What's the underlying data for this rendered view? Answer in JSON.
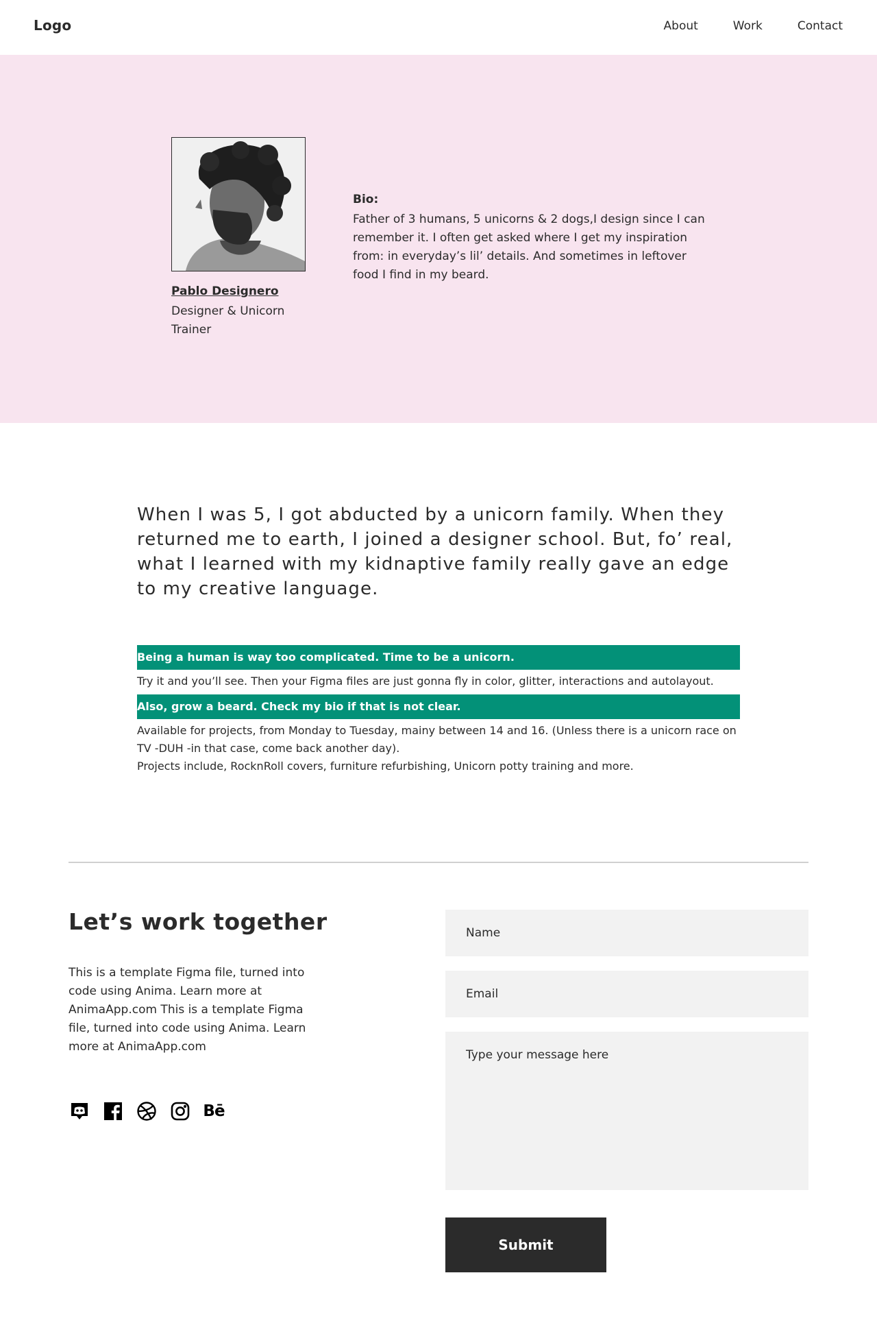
{
  "header": {
    "logo": "Logo",
    "nav": [
      "About",
      "Work",
      "Contact"
    ]
  },
  "hero": {
    "name": "Pablo Designero",
    "role": "Designer & Unicorn Trainer",
    "bio_label": "Bio:",
    "bio_text": "Father of 3 humans, 5 unicorns & 2 dogs,I design since I can remember it. I often get asked where I get my inspiration from: in everyday’s lil’ details. And sometimes in leftover food I find in my beard."
  },
  "story": {
    "quote": "When I was 5, I got abducted by a unicorn family. When they returned me to earth, I joined a designer school. But, fo’ real, what I learned with my kidnaptive family really gave an edge to my creative language.",
    "highlight_1": "Being a human is way too complicated. Time to be a unicorn.",
    "paragraph_1": "Try it and you’ll see. Then your Figma files are just gonna fly in color, glitter, interactions and autolayout.",
    "highlight_2": "Also, grow a beard. Check my bio if that is not clear.",
    "paragraph_2a": "Available for projects, from Monday to Tuesday, mainy between 14 and 16. (Unless there is a unicorn race on TV -DUH -in that case, come back another day).",
    "paragraph_2b": "Projects include, RocknRoll covers, furniture refurbishing, Unicorn potty training and more."
  },
  "contact": {
    "title": "Let’s work together",
    "text": "This is a template Figma file, turned into code using Anima. Learn more at AnimaApp.com This is a template Figma file, turned into code using Anima. Learn more at AnimaApp.com",
    "socials": [
      "discord-icon",
      "facebook-icon",
      "dribbble-icon",
      "instagram-icon",
      "behance-icon"
    ],
    "behance_glyph": "Bē",
    "name_placeholder": "Name",
    "email_placeholder": "Email",
    "message_placeholder": "Type your message here",
    "submit_label": "Submit"
  },
  "colors": {
    "hero_bg": "#f8e4ef",
    "highlight": "#039178",
    "dark": "#2b2b2b",
    "field_bg": "#f2f2f2"
  }
}
